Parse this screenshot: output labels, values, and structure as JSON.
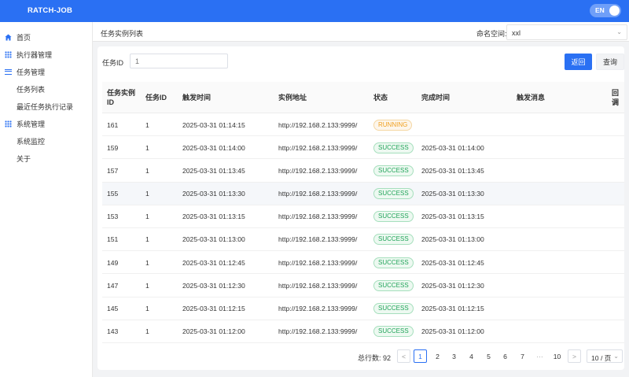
{
  "header": {
    "logo": "RATCH-JOB",
    "lang": "EN"
  },
  "sidebar": {
    "items": [
      {
        "label": "首页",
        "icon": "home-icon"
      },
      {
        "label": "执行器管理",
        "icon": "grid-icon"
      },
      {
        "label": "任务管理",
        "icon": "list-icon"
      },
      {
        "label": "任务列表",
        "icon": ""
      },
      {
        "label": "最近任务执行记录",
        "icon": ""
      },
      {
        "label": "系统管理",
        "icon": "grid-icon"
      },
      {
        "label": "系统监控",
        "icon": ""
      },
      {
        "label": "关于",
        "icon": ""
      }
    ]
  },
  "page": {
    "title": "任务实例列表",
    "namespace_label": "命名空间:",
    "namespace_value": "xxl"
  },
  "filter": {
    "label": "任务ID",
    "value": "1",
    "back_label": "返回",
    "query_label": "查询"
  },
  "table": {
    "columns": [
      "任务实例ID",
      "任务ID",
      "触发时间",
      "实例地址",
      "状态",
      "完成时间",
      "触发消息",
      "回调"
    ],
    "rows": [
      {
        "id": "161",
        "task": "1",
        "trigger": "2025-03-31 01:14:15",
        "addr": "http://192.168.2.133:9999/",
        "status": "RUNNING",
        "done": ""
      },
      {
        "id": "159",
        "task": "1",
        "trigger": "2025-03-31 01:14:00",
        "addr": "http://192.168.2.133:9999/",
        "status": "SUCCESS",
        "done": "2025-03-31 01:14:00"
      },
      {
        "id": "157",
        "task": "1",
        "trigger": "2025-03-31 01:13:45",
        "addr": "http://192.168.2.133:9999/",
        "status": "SUCCESS",
        "done": "2025-03-31 01:13:45"
      },
      {
        "id": "155",
        "task": "1",
        "trigger": "2025-03-31 01:13:30",
        "addr": "http://192.168.2.133:9999/",
        "status": "SUCCESS",
        "done": "2025-03-31 01:13:30"
      },
      {
        "id": "153",
        "task": "1",
        "trigger": "2025-03-31 01:13:15",
        "addr": "http://192.168.2.133:9999/",
        "status": "SUCCESS",
        "done": "2025-03-31 01:13:15"
      },
      {
        "id": "151",
        "task": "1",
        "trigger": "2025-03-31 01:13:00",
        "addr": "http://192.168.2.133:9999/",
        "status": "SUCCESS",
        "done": "2025-03-31 01:13:00"
      },
      {
        "id": "149",
        "task": "1",
        "trigger": "2025-03-31 01:12:45",
        "addr": "http://192.168.2.133:9999/",
        "status": "SUCCESS",
        "done": "2025-03-31 01:12:45"
      },
      {
        "id": "147",
        "task": "1",
        "trigger": "2025-03-31 01:12:30",
        "addr": "http://192.168.2.133:9999/",
        "status": "SUCCESS",
        "done": "2025-03-31 01:12:30"
      },
      {
        "id": "145",
        "task": "1",
        "trigger": "2025-03-31 01:12:15",
        "addr": "http://192.168.2.133:9999/",
        "status": "SUCCESS",
        "done": "2025-03-31 01:12:15"
      },
      {
        "id": "143",
        "task": "1",
        "trigger": "2025-03-31 01:12:00",
        "addr": "http://192.168.2.133:9999/",
        "status": "SUCCESS",
        "done": "2025-03-31 01:12:00"
      }
    ]
  },
  "pagination": {
    "total_label": "总行数: 92",
    "prev": "<",
    "pages": [
      "1",
      "2",
      "3",
      "4",
      "5",
      "6",
      "7"
    ],
    "ellipsis": "···",
    "last": "10",
    "next": ">",
    "page_size": "10 / 页"
  },
  "colors": {
    "primary": "#2a70f3",
    "success": "#22a45a",
    "running": "#f0a020"
  }
}
